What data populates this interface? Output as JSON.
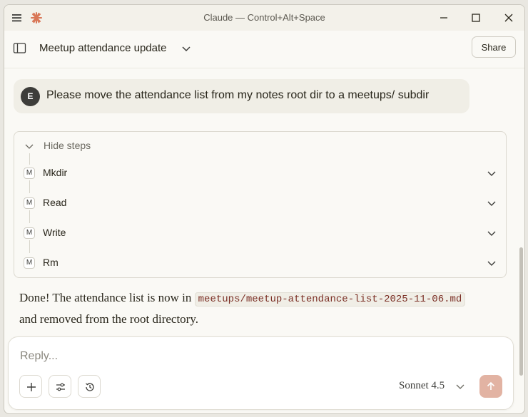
{
  "window": {
    "title": "Claude — Control+Alt+Space"
  },
  "header": {
    "conversation_title": "Meetup attendance update",
    "share_label": "Share"
  },
  "user_message": {
    "avatar_initial": "E",
    "text": "Please move the attendance list from my notes root dir to a meetups/ subdir"
  },
  "steps": {
    "toggle_label": "Hide steps",
    "items": [
      {
        "badge": "M",
        "label": "Mkdir"
      },
      {
        "badge": "M",
        "label": "Read"
      },
      {
        "badge": "M",
        "label": "Write"
      },
      {
        "badge": "M",
        "label": "Rm"
      }
    ]
  },
  "assistant_reply": {
    "before": "Done! The attendance list is now in ",
    "path": "meetups/meetup-attendance-list-2025-11-06.md",
    "after": " and removed from the root directory."
  },
  "composer": {
    "placeholder": "Reply...",
    "model": "Sonnet 4.5"
  },
  "colors": {
    "accent": "#d97757",
    "send_button": "#e2b3a3",
    "avatar_bg": "#3d3d3a"
  }
}
